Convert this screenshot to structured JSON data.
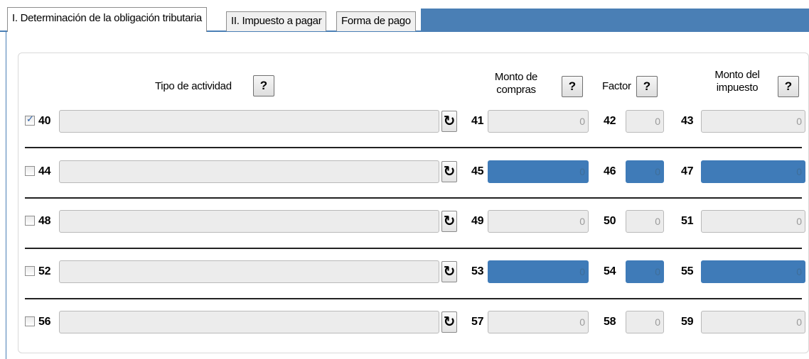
{
  "tabs": [
    {
      "label": "I. Determinación de la obligación tributaria",
      "active": true
    },
    {
      "label": "II. Impuesto a pagar",
      "active": false
    },
    {
      "label": "Forma de pago",
      "active": false
    }
  ],
  "headers": {
    "tipo": "Tipo de actividad",
    "monto_compras_1": "Monto de",
    "monto_compras_2": "compras",
    "factor": "Factor",
    "monto_impuesto_1": "Monto del",
    "monto_impuesto_2": "impuesto",
    "help_label": "?"
  },
  "refresh_symbol": "↻",
  "rows": [
    {
      "checked": true,
      "n1": "40",
      "activity": "",
      "n2": "41",
      "compras": "0",
      "n3": "42",
      "factor": "0",
      "n4": "43",
      "impuesto": "0",
      "highlighted": false
    },
    {
      "checked": false,
      "n1": "44",
      "activity": "",
      "n2": "45",
      "compras": "0",
      "n3": "46",
      "factor": "0",
      "n4": "47",
      "impuesto": "0",
      "highlighted": true
    },
    {
      "checked": false,
      "n1": "48",
      "activity": "",
      "n2": "49",
      "compras": "0",
      "n3": "50",
      "factor": "0",
      "n4": "51",
      "impuesto": "0",
      "highlighted": false
    },
    {
      "checked": false,
      "n1": "52",
      "activity": "",
      "n2": "53",
      "compras": "0",
      "n3": "54",
      "factor": "0",
      "n4": "55",
      "impuesto": "0",
      "highlighted": true
    },
    {
      "checked": false,
      "n1": "56",
      "activity": "",
      "n2": "57",
      "compras": "0",
      "n3": "58",
      "factor": "0",
      "n4": "59",
      "impuesto": "0",
      "highlighted": false
    }
  ],
  "colors": {
    "tab_strip": "#4a7fb5",
    "highlight_field": "#3f7bb8"
  }
}
